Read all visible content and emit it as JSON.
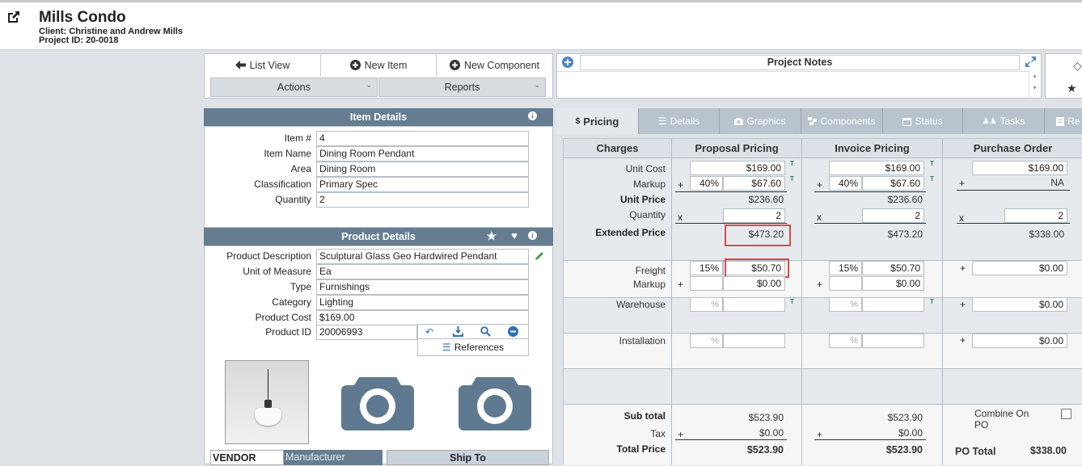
{
  "project": {
    "title": "Mills Condo",
    "client": "Client: Christine and Andrew Mills",
    "project_id": "Project ID: 20-0018"
  },
  "toolbar": {
    "list_view": "List View",
    "new_item": "New Item",
    "new_component": "New Component",
    "actions": "Actions",
    "reports": "Reports"
  },
  "notes": {
    "title": "Project Notes"
  },
  "item_details": {
    "header": "Item Details",
    "fields": [
      {
        "label": "Item #",
        "value": "4"
      },
      {
        "label": "Item Name",
        "value": "Dining Room Pendant"
      },
      {
        "label": "Area",
        "value": "Dining Room"
      },
      {
        "label": "Classification",
        "value": "Primary Spec"
      },
      {
        "label": "Quantity",
        "value": "2"
      }
    ]
  },
  "product_details": {
    "header": "Product Details",
    "fields": [
      {
        "label": "Product Description",
        "value": "Sculptural Glass Geo Hardwired Pendant"
      },
      {
        "label": "Unit of Measure",
        "value": "Ea"
      },
      {
        "label": "Type",
        "value": "Furnishings"
      },
      {
        "label": "Category",
        "value": "Lighting"
      },
      {
        "label": "Product Cost",
        "value": "$169.00"
      },
      {
        "label": "Product ID",
        "value": "20006993"
      }
    ],
    "references": "References"
  },
  "vendor_tabs": {
    "vendor": "VENDOR",
    "manufacturer": "Manufacturer",
    "ship_to": "Ship To"
  },
  "tabs": [
    "Pricing",
    "Details",
    "Graphics",
    "Components",
    "Status",
    "Tasks",
    "Re"
  ],
  "pricing": {
    "headers": [
      "Charges",
      "Proposal Pricing",
      "Invoice Pricing",
      "Purchase Order"
    ],
    "labels": {
      "unit_cost": "Unit Cost",
      "markup": "Markup",
      "unit_price": "Unit Price",
      "quantity": "Quantity",
      "extended_price": "Extended Price",
      "freight": "Freight",
      "freight_markup": "Markup",
      "warehouse": "Warehouse",
      "installation": "Installation",
      "subtotal": "Sub total",
      "tax": "Tax",
      "total_price": "Total Price",
      "combine_on_po": "Combine On PO",
      "po_total": "PO Total"
    },
    "proposal": {
      "unit_cost": "$169.00",
      "markup_pct": "40%",
      "markup": "$67.60",
      "unit_price": "$236.60",
      "quantity": "2",
      "extended_price": "$473.20",
      "freight_pct": "15%",
      "freight": "$50.70",
      "freight_markup": "$0.00",
      "subtotal": "$523.90",
      "tax": "$0.00",
      "total": "$523.90"
    },
    "invoice": {
      "unit_cost": "$169.00",
      "markup_pct": "40%",
      "markup": "$67.60",
      "unit_price": "$236.60",
      "quantity": "2",
      "extended_price": "$473.20",
      "freight_pct": "15%",
      "freight": "$50.70",
      "freight_markup": "$0.00",
      "subtotal": "$523.90",
      "tax": "$0.00",
      "total": "$523.90"
    },
    "purchase_order": {
      "unit_cost": "$169.00",
      "markup": "NA",
      "quantity": "2",
      "extended_price": "$338.00",
      "freight": "$0.00",
      "warehouse": "$0.00",
      "installation": "$0.00",
      "total": "$338.00"
    },
    "pct_placeholder": "%",
    "ops": {
      "plus": "+",
      "times": "x",
      "t": "T"
    }
  },
  "colors": {
    "header_bar": "#667d91",
    "highlight": "#e0484a",
    "accent": "#4d82c4"
  }
}
